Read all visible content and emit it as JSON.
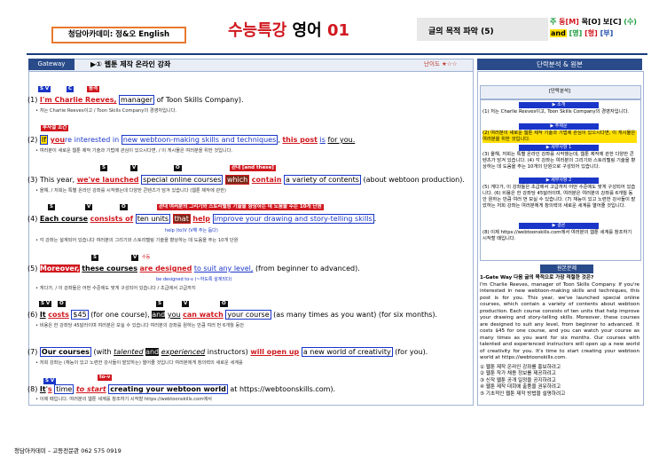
{
  "header": {
    "academy": "청담아카데미: 정&오 English",
    "title_kr": "수능특강",
    "title_sub": "영어",
    "title_num": "01",
    "topic": "글의 목적 파악 (5)",
    "legend_line1": "주",
    "legend_line1b": "동",
    "legend_line1c": "[M]",
    "legend_line1d": "목",
    "legend_line1e": "[O]",
    "legend_line1f": "보",
    "legend_line1g": "[C]",
    "legend_line1h": "(수)",
    "legend_line2a": "and",
    "legend_line2b": "[명]",
    "legend_line2c": "[형]",
    "legend_line2d": "[부]"
  },
  "gateway": {
    "tag": "Gateway",
    "text": "▶① 웹툰 제작 온라인 강좌",
    "difficulty": "난이도 ★☆☆"
  },
  "right_header": "단락분석 & 원본",
  "sentences": [
    {
      "num": "(1)",
      "parts": [
        "I'm Charlie Reeves,",
        "manager",
        "of Toon Skills Company)."
      ],
      "trans": "• 저는 Charlie Reeves이고   / Toon Skills Company의 경영자입니다."
    },
    {
      "num": "(2)",
      "parts": [
        "If",
        "you",
        "re interested in",
        "new webtoon-making skills and techniques",
        ", ",
        "this post",
        "is",
        "for you."
      ],
      "trans": "• 여러분이 새로운 웹툰 제작 기술과 기법에 관심이 있으시다면,                      / 이 게시물은 여러분을 위한 것입니다."
    },
    {
      "num": "(3)",
      "parts": [
        "This year,",
        "we've launched",
        "special online courses",
        "which",
        "contain",
        "a variety of contents",
        "(about webtoon production)."
      ],
      "trans": "• 올해,      / 저희는 특별 온라인 강좌를 시작했는데                         다양한 콘텐츠가 담겨 있습니다             (웹툰 제작에 관한)"
    },
    {
      "num": "(4)",
      "parts": [
        "Each course",
        "consists of",
        "ten units",
        "that",
        "help",
        "improve your drawing and story-telling skills",
        "."
      ],
      "trans": "• 각 강좌는      설계되어 있습니다    여러분의 그리기와 스토리텔링 기술을 향상하는 데 도움을 주는 10개 단원"
    },
    {
      "num": "(5)",
      "parts": [
        "Moreover,",
        "these courses",
        "are designed",
        "to suit any level,",
        "(from beginner to advanced)."
      ],
      "trans": "• 게다가,     /        이 강좌들은 어떤 수준에도 맞게 구성되어 있습니다       / 초급에서 고급까지"
    },
    {
      "num": "(6)",
      "parts": [
        "It",
        "costs",
        "$45",
        "(for one course),",
        "and",
        "you",
        "can watch",
        "your course",
        "(as many times as you want)",
        "(for six months)."
      ],
      "trans": "• 비용은 한 강좌당 45달러이며          여러분은 보실 수 있습니다 여러분의 강좌를            원하는 만큼 여러 번                6개월 동안"
    },
    {
      "num": "(7)",
      "parts": [
        "Our courses",
        "(with",
        "talented",
        "and",
        "experienced",
        "instructors)",
        "will open up",
        "a new world of creativity",
        "(for you)."
      ],
      "trans": "• 저희 강좌는           (재능이 있고 노련한 강사들이 맡았하는)                     열어줄 것입니다   여러분에게 창의력의 새로운 세계를"
    },
    {
      "num": "(8)",
      "parts": [
        "It",
        "s",
        "time",
        "to start",
        "creating your webtoon world",
        "at https://webtoonskills.com)."
      ],
      "trans": "• 이제     때입니다.        여러분의 웹툰 세계를 창조하기 시작할                 https://webtoonskills.com에서"
    }
  ],
  "annotations": {
    "s2_a": "부사절 조건",
    "s3_a": "관대 [and these]",
    "s4_a": "관대 여러분의 그리기와 스토리텔링 기술을 향상하는 데 도움을 주는 10개 단원",
    "s4_b": "help (to)V (V해 주는 돕다)",
    "s5_a": "수동",
    "s5_b": "be designed to-v (~하도록 설계되다)",
    "s8_a": "to-v"
  },
  "analysis": {
    "label": "[단락분석]",
    "chip1": "▶ 소개",
    "item1": "(1) 저는 Charlie Reeves이고, Toon Skills Company의 경영자입니다.",
    "chip2": "▶ 주제문",
    "item2": "(2) 여러분이 새로운 웹툰 제작 기술과 기법에 관심이 있으시다면, 이 게시물은 여러분을 위한 것입니다.",
    "chip3": "▶ 세부사항 1",
    "item3": "(3) 올해, 저희는 특별 온라인 강좌를 시작했는데, 웹툰 제작에 관한 다양한 콘텐츠가 담겨 있습니다. (4) 각 강좌는 여러분의 그리기와 스토리텔링 기술을 향상하는 데 도움을 주는 10개의 단원으로 구성되어 있습니다.",
    "chip4": "▶ 세부사항 2",
    "item4": "(5) 게다가, 이 강좌들은 초급에서 고급까지 어떤 수준에도 맞게 구성되어 있습니다. (6) 비용은 한 강좌당 45달러이며, 여러분은 여러분의 강좌를 6개월 동안 원하는 만큼 여러 번 보실 수 있습니다. (7) 재능이 있고 노련한 강사들이 맡았하는 저희 강좌는 여러분에게 창의력의 새로운 세계를 열어줄 것입니다.",
    "chip5": "▶ 결론",
    "item5": "(8) 이제 https://webtoonskills.com에서 여러분의 웹툰 세계를 창조하기 시작할 때입니다."
  },
  "worksheet": {
    "head": "원본문제",
    "question": "1-Gate Way 다음 글의 목적으로 가장 적절한 것은?",
    "passage": "I'm Charlie Reeves, manager of Toon Skills Company. If you're interested in new webtoon-making skills and techniques, this post is for you. This year, we've launched special online courses, which contain a variety of contents about webtoon production. Each course consists of ten units that help improve your drawing and story-telling skills. Moreover, these courses are designed to suit any level, from beginner to advanced. It costs $45 for one course, and you can watch your course as many times as you want for six months. Our courses with talented and experienced instructors will open up a new world of creativity for you. It's time to start creating your webtoon world at https://webtoonskills.com.",
    "options": [
      "① 웹툰 제작 온라인 강좌를 홍보하려고",
      "② 웹툰 작가 채용 정보를 제공하려고",
      "③ 신작 웹툰 공개 일정을 공지하려고",
      "④ 웹툰 제작 대회에 출품을 권유하려고",
      "⑤ 기초적인 웹툰 제작 방법을 설명하려고"
    ]
  },
  "footer": "청담아카데미 – 고등전문관 062 575 0919"
}
